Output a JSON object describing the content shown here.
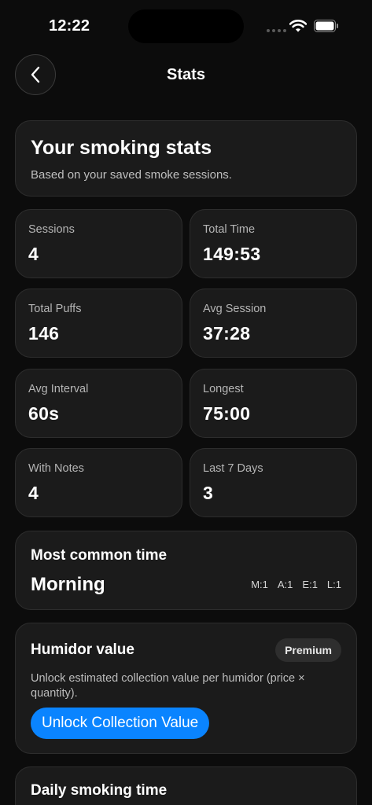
{
  "status_bar": {
    "time": "12:22"
  },
  "nav": {
    "title": "Stats"
  },
  "header": {
    "title": "Your smoking stats",
    "subtitle": "Based on your saved smoke sessions."
  },
  "stats": [
    {
      "label": "Sessions",
      "value": "4"
    },
    {
      "label": "Total Time",
      "value": "149:53"
    },
    {
      "label": "Total Puffs",
      "value": "146"
    },
    {
      "label": "Avg Session",
      "value": "37:28"
    },
    {
      "label": "Avg Interval",
      "value": "60s"
    },
    {
      "label": "Longest",
      "value": "75:00"
    },
    {
      "label": "With Notes",
      "value": "4"
    },
    {
      "label": "Last 7 Days",
      "value": "3"
    }
  ],
  "most_common": {
    "title": "Most common time",
    "value": "Morning",
    "breakdown": [
      "M:1",
      "A:1",
      "E:1",
      "L:1"
    ]
  },
  "humidor": {
    "title": "Humidor value",
    "badge": "Premium",
    "description": "Unlock estimated collection value per humidor (price × quantity).",
    "button": "Unlock Collection Value"
  },
  "daily": {
    "title": "Daily smoking time"
  },
  "colors": {
    "accent": "#0a84ff",
    "card": "#1b1b1b",
    "background": "#0c0c0c"
  }
}
